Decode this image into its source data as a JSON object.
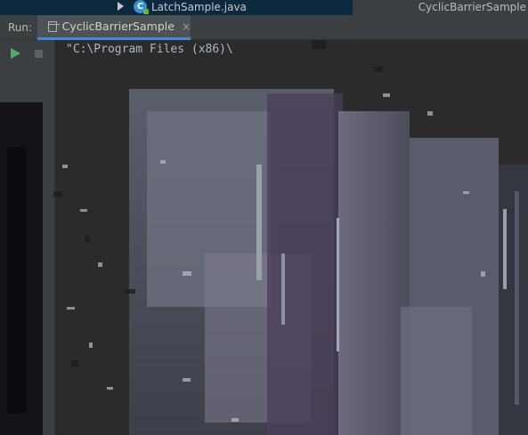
{
  "project_tree": {
    "file_name": "LatchSample.java",
    "class_icon_letter": "C",
    "icon": "java-class-icon",
    "expand_icon": "chevron-right-icon"
  },
  "editor": {
    "title": "CyclicBarrierSample"
  },
  "run_panel": {
    "label": "Run:",
    "tab": {
      "label": "CyclicBarrierSample",
      "close": "×",
      "icon": "run-config-icon"
    },
    "toolbar": [
      {
        "name": "rerun",
        "icon": "play-icon",
        "color": "#59a869"
      },
      {
        "name": "stop",
        "icon": "stop-icon",
        "color": "#5e6163"
      }
    ]
  },
  "console": {
    "first_line": "\"C:\\Program Files (x86)\\"
  },
  "colors": {
    "tree_bg": "#0d293e",
    "panel_bg": "#3c3f41",
    "console_bg": "#2b2b2b",
    "tab_underline": "#4a88c7",
    "text": "#bbbbbb"
  }
}
